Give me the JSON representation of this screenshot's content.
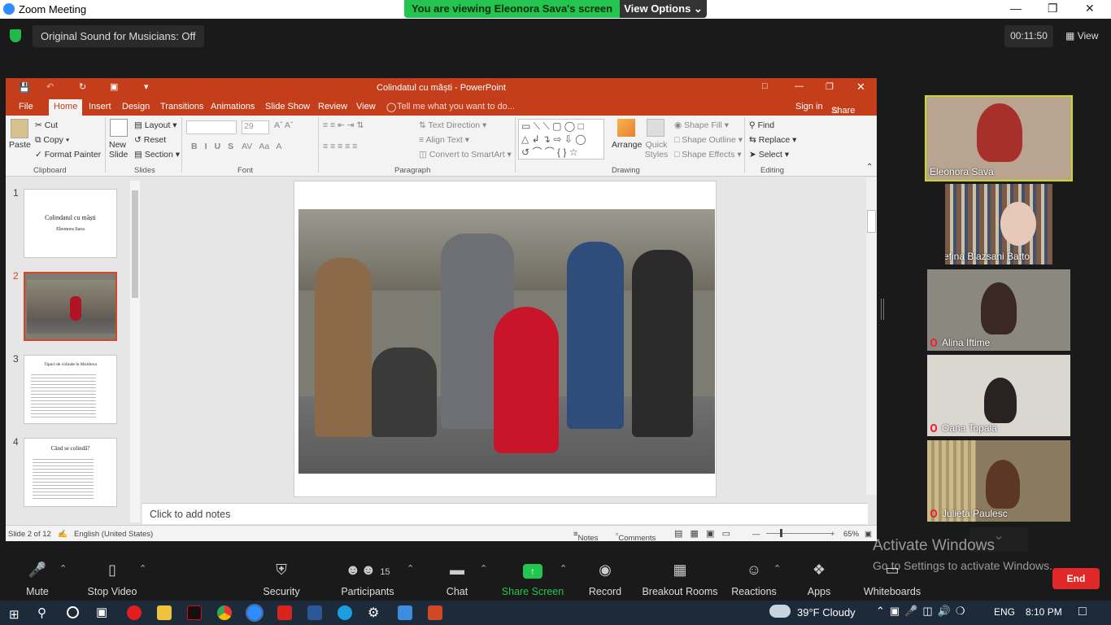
{
  "zoom": {
    "window_title": "Zoom Meeting",
    "banner_text": "You are viewing Eleonora Sava's screen",
    "view_options": "View Options",
    "original_sound": "Original Sound for Musicians: Off",
    "timer": "00:11:50",
    "view_label": "View"
  },
  "ppt": {
    "title": "Colindatul cu măști - PowerPoint",
    "tabs": [
      "File",
      "Home",
      "Insert",
      "Design",
      "Transitions",
      "Animations",
      "Slide Show",
      "Review",
      "View"
    ],
    "tell_me": "Tell me what you want to do...",
    "sign_in": "Sign in",
    "share": "Share",
    "ribbon": {
      "paste": "Paste",
      "cut": "Cut",
      "copy": "Copy",
      "format_painter": "Format Painter",
      "new_slide": "New Slide",
      "layout": "Layout",
      "reset": "Reset",
      "section": "Section",
      "font_size": "29",
      "text_direction": "Text Direction",
      "align_text": "Align Text",
      "convert_smartart": "Convert to SmartArt",
      "arrange": "Arrange",
      "quick_styles": "Quick Styles",
      "shape_fill": "Shape Fill",
      "shape_outline": "Shape Outline",
      "shape_effects": "Shape Effects",
      "find": "Find",
      "replace": "Replace",
      "select": "Select",
      "groups": [
        "Clipboard",
        "Slides",
        "Font",
        "Paragraph",
        "Drawing",
        "Editing"
      ]
    },
    "slides": [
      {
        "num": "1",
        "title": "Colindatul cu măști",
        "sub": "Eleonora Sava"
      },
      {
        "num": "2",
        "title": "",
        "sub": ""
      },
      {
        "num": "3",
        "title": "Tipuri de colinde în Moldova",
        "sub": ""
      },
      {
        "num": "4",
        "title": "Când se colindă?",
        "sub": ""
      }
    ],
    "notes_placeholder": "Click to add notes",
    "status": {
      "slide_pos": "Slide 2 of 12",
      "language": "English (United States)",
      "notes": "Notes",
      "comments": "Comments",
      "zoom": "65%"
    }
  },
  "participants": [
    {
      "name": "Eleonora Sava",
      "muted": false,
      "active": true
    },
    {
      "name": "Iosefina Blazsani Batto",
      "muted": false,
      "active": false
    },
    {
      "name": "Alina Iftime",
      "muted": true,
      "active": false
    },
    {
      "name": "Oana Topala",
      "muted": true,
      "active": false
    },
    {
      "name": "Julieta Paulesc",
      "muted": true,
      "active": false
    }
  ],
  "toolbar": {
    "mute": "Mute",
    "stop_video": "Stop Video",
    "security": "Security",
    "participants": "Participants",
    "participants_count": "15",
    "chat": "Chat",
    "share_screen": "Share Screen",
    "record": "Record",
    "breakout": "Breakout Rooms",
    "reactions": "Reactions",
    "apps": "Apps",
    "whiteboards": "Whiteboards",
    "end": "End"
  },
  "activate": {
    "line1": "Activate Windows",
    "line2": "Go to Settings to activate Windows."
  },
  "taskbar": {
    "weather": "39°F  Cloudy",
    "lang": "ENG",
    "time": "8:10 PM"
  }
}
